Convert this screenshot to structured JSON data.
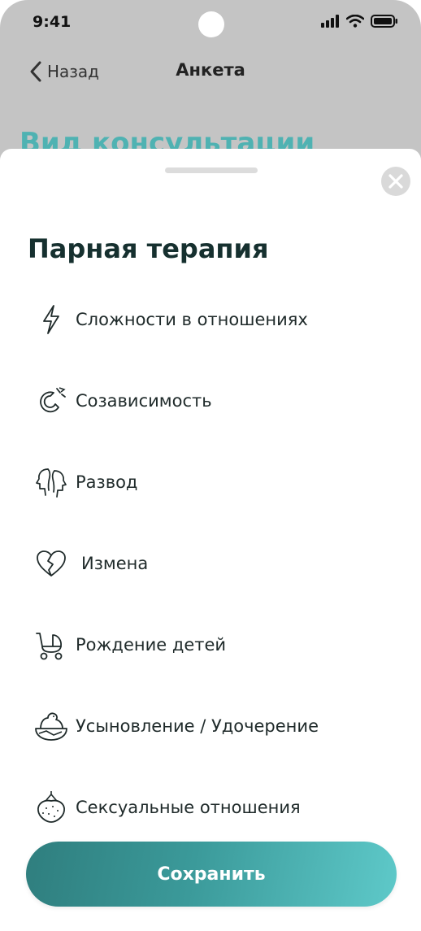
{
  "status_bar": {
    "time": "9:41"
  },
  "nav": {
    "back_label": "Назад",
    "title": "Анкета"
  },
  "background_heading": "Вид консультации",
  "sheet": {
    "title": "Парная терапия",
    "options": [
      {
        "label": "Сложности в отношениях",
        "icon": "lightning-icon"
      },
      {
        "label": "Созависимость",
        "icon": "magnet-icon"
      },
      {
        "label": "Развод",
        "icon": "faces-apart-icon"
      },
      {
        "label": "Измена",
        "icon": "broken-heart-icon"
      },
      {
        "label": "Рождение детей",
        "icon": "stroller-icon"
      },
      {
        "label": "Усыновление / Удочерение",
        "icon": "nest-icon"
      },
      {
        "label": "Сексуальные отношения",
        "icon": "strawberry-icon"
      }
    ],
    "save_label": "Сохранить"
  },
  "colors": {
    "accent": "#4fb2b2",
    "title_text": "#16302f",
    "backdrop": "#c4c4c4",
    "button_gradient_start": "#2f7e7e",
    "button_gradient_end": "#5ec9c9"
  }
}
